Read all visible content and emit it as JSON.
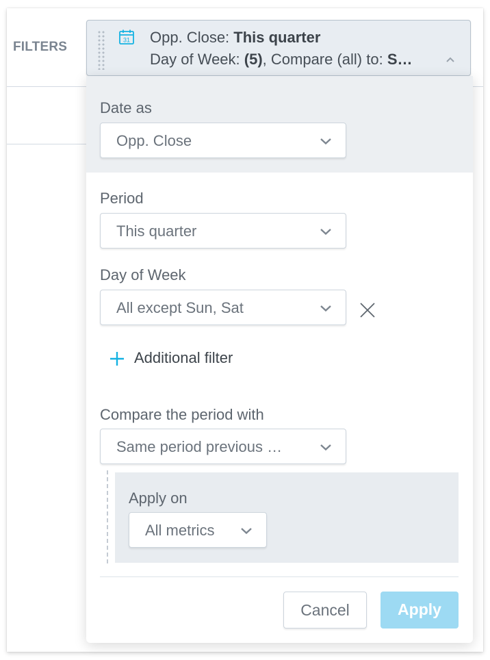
{
  "header": {
    "filters_label": "FILTERS"
  },
  "date_filter_button": {
    "icon": "calendar-icon",
    "calendar_day": "31",
    "line1_prefix": "Opp. Close: ",
    "line1_value": "This quarter",
    "line2_prefix": "Day of Week: ",
    "line2_count": "(5)",
    "line2_mid": ", Compare (all) to: ",
    "line2_value": "S…",
    "chevron": "chevron-up-icon"
  },
  "dropdown": {
    "date_as": {
      "label": "Date as",
      "value": "Opp. Close"
    },
    "period": {
      "label": "Period",
      "value": "This quarter"
    },
    "day_of_week": {
      "label": "Day of Week",
      "value": "All except Sun, Sat"
    },
    "additional_filter": {
      "label": "Additional filter"
    },
    "compare": {
      "label": "Compare the period with",
      "value": "Same period previous …"
    },
    "apply_on": {
      "label": "Apply on",
      "value": "All metrics"
    },
    "buttons": {
      "cancel": "Cancel",
      "apply": "Apply"
    }
  },
  "colors": {
    "accent": "#14b2e2",
    "apply_disabled": "#9ddaf3",
    "panel_gray": "#eceff2"
  }
}
